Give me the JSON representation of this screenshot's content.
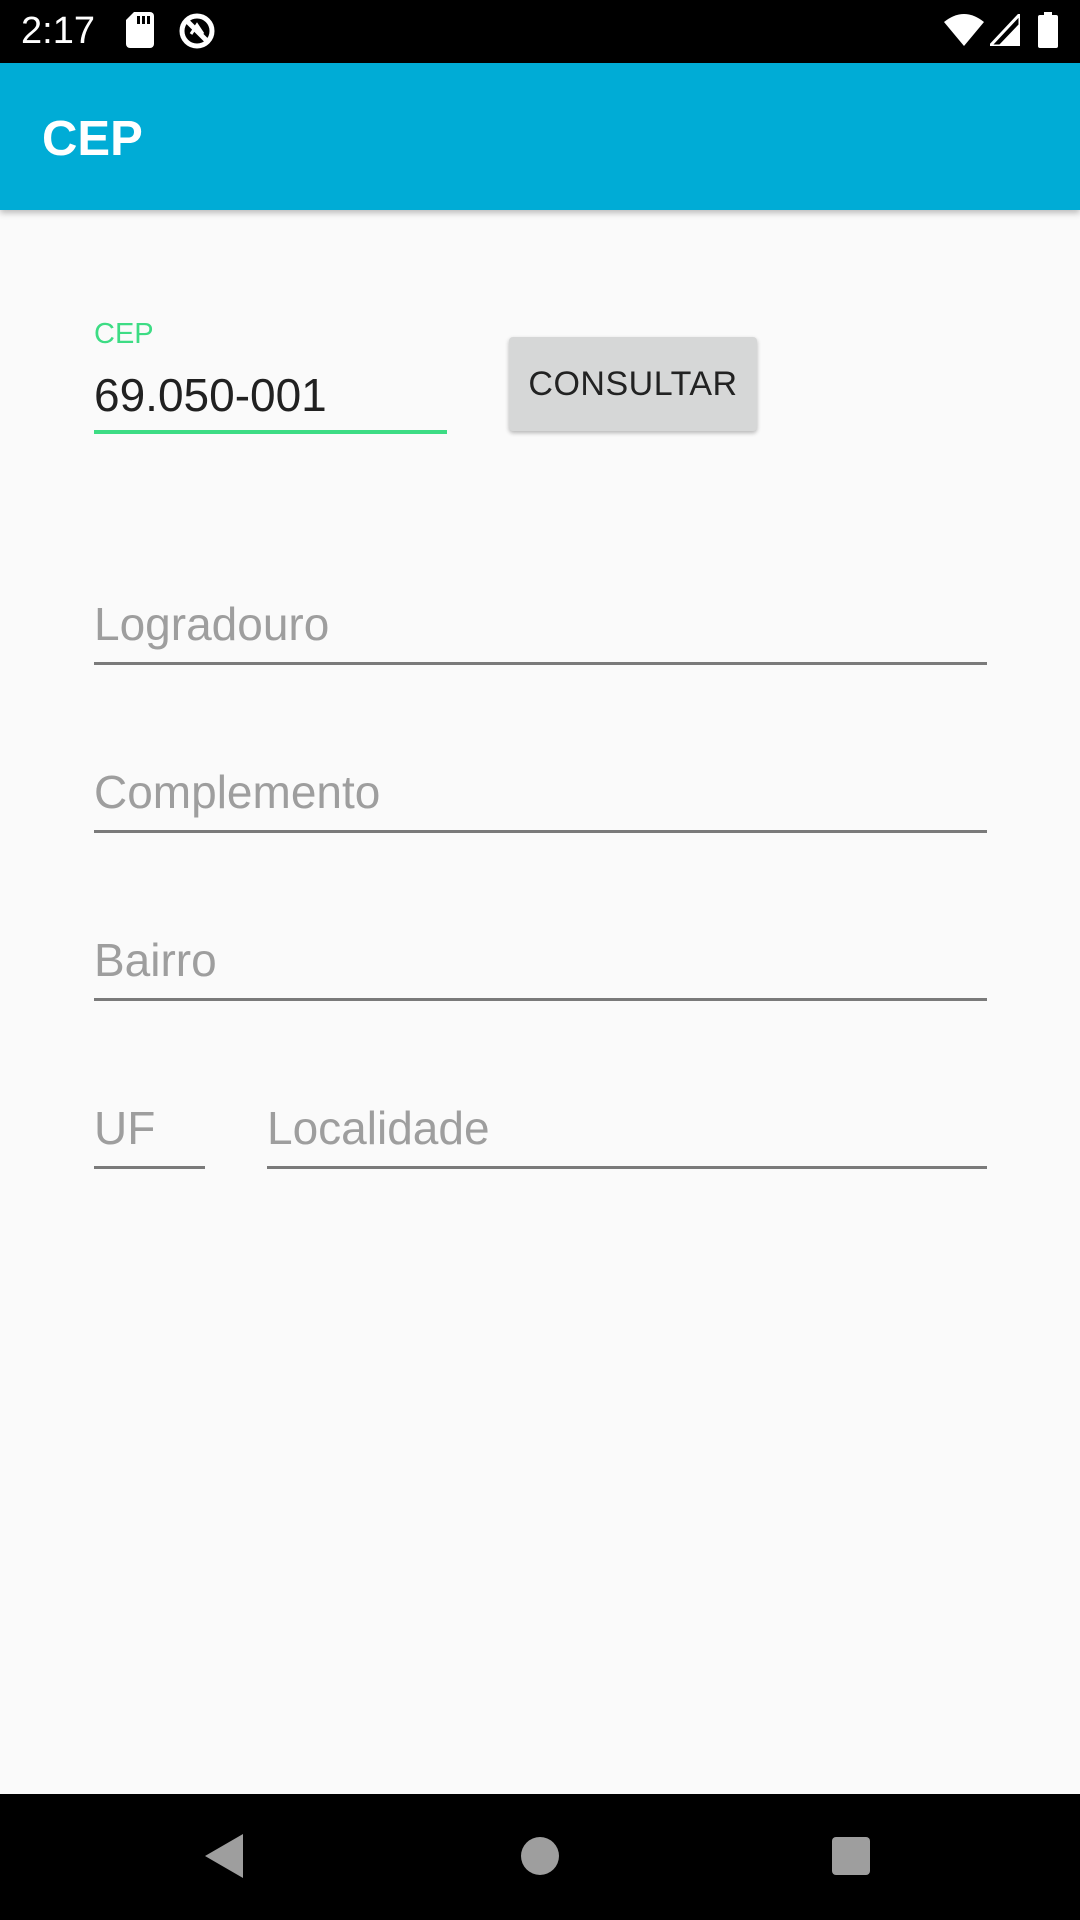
{
  "status_bar": {
    "time": "2:17",
    "icons": [
      "sd-card-icon",
      "no-sync-icon",
      "wifi-icon",
      "signal-icon",
      "battery-icon"
    ]
  },
  "app_bar": {
    "title": "CEP",
    "color": "#00acd6"
  },
  "form": {
    "cep": {
      "label": "CEP",
      "value": "69.050-001",
      "accent_color": "#3ddc84"
    },
    "consultar_label": "CONSULTAR",
    "logradouro_hint": "Logradouro",
    "complemento_hint": "Complemento",
    "bairro_hint": "Bairro",
    "uf_hint": "UF",
    "localidade_hint": "Localidade"
  },
  "nav_bar": {
    "icons": [
      "back-icon",
      "home-icon",
      "recents-icon"
    ]
  }
}
